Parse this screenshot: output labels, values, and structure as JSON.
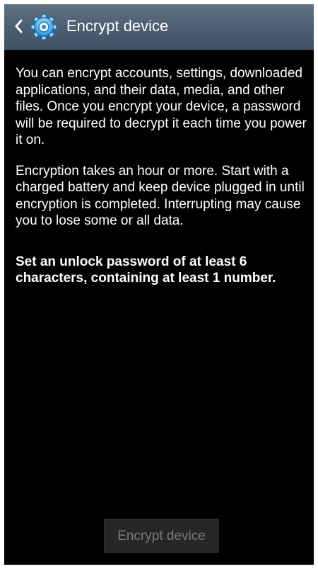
{
  "action_bar": {
    "title": "Encrypt device",
    "back_icon": "chevron-left-icon",
    "app_icon": "settings-gear-icon",
    "background_color": "#4c5e70"
  },
  "body": {
    "paragraph_1": "You can encrypt accounts, settings, downloaded applications, and their data, media, and other files. Once you encrypt your device, a password will be required to decrypt it each time you power it on.",
    "paragraph_2": "Encryption takes an hour or more. Start with a charged battery and keep device plugged in until encryption is completed. Interrupting may cause you to lose some or all data.",
    "requirement": "Set an unlock password of at least 6 characters, containing at least 1 number."
  },
  "footer": {
    "encrypt_button_label": "Encrypt device",
    "encrypt_button_enabled": false
  },
  "colors": {
    "screen_background": "#000000",
    "text": "#ffffff",
    "disabled_button_text": "#7a7a7a"
  }
}
